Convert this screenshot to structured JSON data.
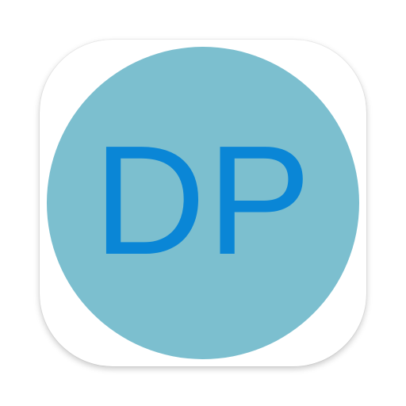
{
  "app_icon": {
    "monogram": "DP",
    "colors": {
      "tile_background": "#ffffff",
      "disc_fill": "#7cbfcf",
      "monogram_text": "#0a86d6"
    }
  }
}
